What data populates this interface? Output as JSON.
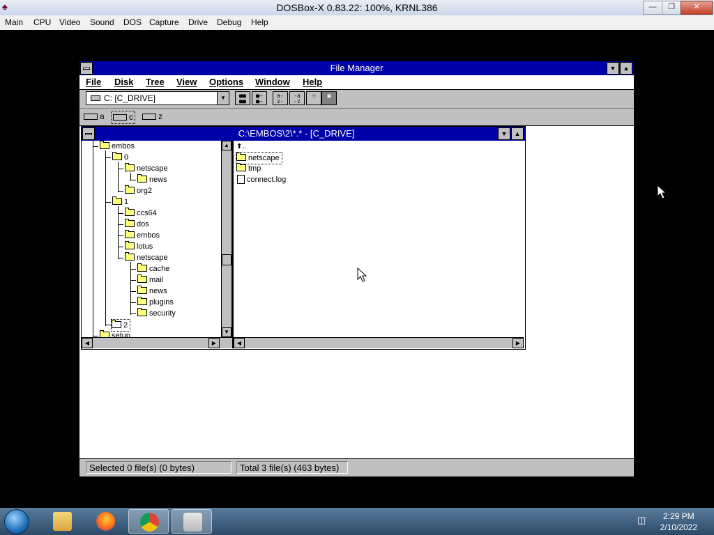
{
  "host": {
    "title": "DOSBox-X 0.83.22: 100%, KRNL386",
    "menu": [
      "Main",
      "CPU",
      "Video",
      "Sound",
      "DOS",
      "Capture",
      "Drive",
      "Debug",
      "Help"
    ]
  },
  "file_manager": {
    "title": "File Manager",
    "menu": [
      "File",
      "Disk",
      "Tree",
      "View",
      "Options",
      "Window",
      "Help"
    ],
    "drive_select": "C: [C_DRIVE]",
    "drives": [
      "a",
      "c",
      "z"
    ],
    "selected_drive": "c",
    "child_window": {
      "title": "C:\\EMBOS\\2\\*.* - [C_DRIVE]",
      "tree": [
        {
          "label": "embos"
        },
        {
          "label": "0"
        },
        {
          "label": "netscape"
        },
        {
          "label": "news"
        },
        {
          "label": "org2"
        },
        {
          "label": "1"
        },
        {
          "label": "ccs64"
        },
        {
          "label": "dos"
        },
        {
          "label": "embos"
        },
        {
          "label": "lotus"
        },
        {
          "label": "netscape"
        },
        {
          "label": "cache"
        },
        {
          "label": "mail"
        },
        {
          "label": "news"
        },
        {
          "label": "plugins"
        },
        {
          "label": "security"
        },
        {
          "label": "2"
        },
        {
          "label": "setup"
        }
      ],
      "up_label": "..",
      "files": [
        {
          "label": "netscape",
          "type": "folder"
        },
        {
          "label": "tmp",
          "type": "folder"
        },
        {
          "label": "connect.log",
          "type": "file"
        }
      ]
    },
    "status": {
      "selected": "Selected 0 file(s) (0 bytes)",
      "total": "Total 3 file(s) (463 bytes)"
    }
  },
  "taskbar": {
    "time": "2:29 PM",
    "date": "2/10/2022"
  }
}
